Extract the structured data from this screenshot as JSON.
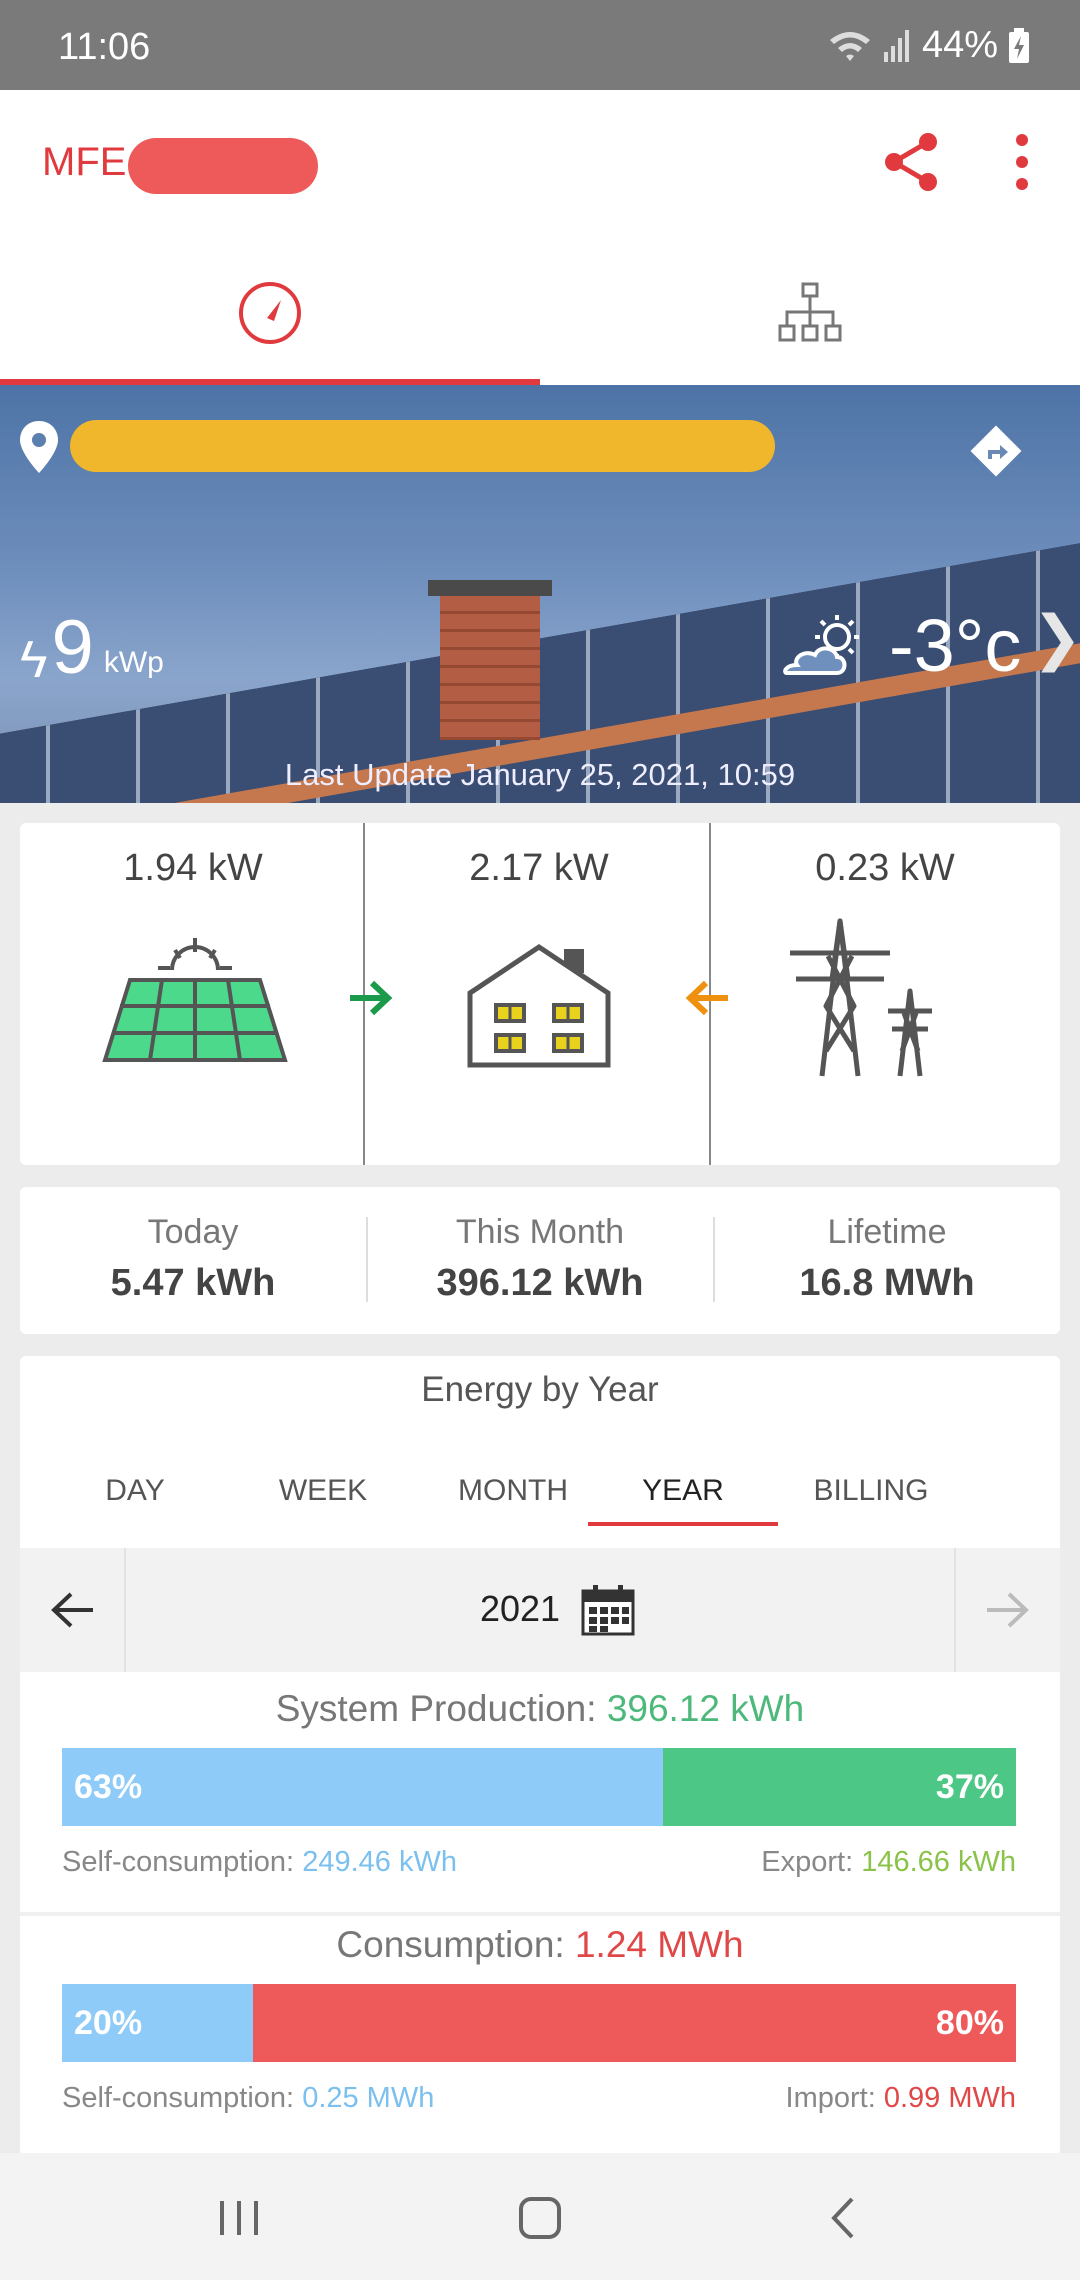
{
  "status": {
    "time": "11:06",
    "battery": "44%"
  },
  "app": {
    "title": "MFE K"
  },
  "tabs": [
    {
      "name": "dashboard"
    },
    {
      "name": "layout"
    }
  ],
  "hero": {
    "system_size": "9",
    "system_unit": "kWp",
    "bolt": "ϟ",
    "temperature": "-3°c",
    "last_update": "Last Update January 25, 2021, 10:59"
  },
  "flow": {
    "production": "1.94 kW",
    "consumption": "2.17 kW",
    "grid": "0.23 kW",
    "colors": {
      "solar": "#4cd98b",
      "export": "#1a9a4a",
      "import": "#f0900f",
      "window": "#e8d21c"
    }
  },
  "totals": [
    {
      "label": "Today",
      "value": "5.47 kWh"
    },
    {
      "label": "This Month",
      "value": "396.12 kWh"
    },
    {
      "label": "Lifetime",
      "value": "16.8 MWh"
    }
  ],
  "energy": {
    "title": "Energy by Year",
    "periods": [
      "DAY",
      "WEEK",
      "MONTH",
      "YEAR",
      "BILLING"
    ],
    "active_period": "YEAR",
    "year": "2021",
    "production": {
      "label": "System Production:",
      "value": "396.12 kWh",
      "self_pct": 63,
      "export_pct": 37,
      "self_pct_text": "63%",
      "export_pct_text": "37%",
      "self_label": "Self-consumption:",
      "self_value": "249.46 kWh",
      "export_label": "Export:",
      "export_value": "146.66 kWh"
    },
    "consumption": {
      "label": "Consumption:",
      "value": "1.24 MWh",
      "self_pct": 20,
      "import_pct": 80,
      "self_pct_text": "20%",
      "import_pct_text": "80%",
      "self_label": "Self-consumption:",
      "self_value": "0.25 MWh",
      "import_label": "Import:",
      "import_value": "0.99 MWh"
    },
    "colors": {
      "self": "#8ecbf8",
      "export": "#4cc785",
      "import": "#ee5a5a",
      "self_text": "#7cc0ef",
      "export_text": "#8bc34a",
      "import_text": "#e04848",
      "production_text": "#4cb97a",
      "consumption_text": "#e04848"
    }
  }
}
